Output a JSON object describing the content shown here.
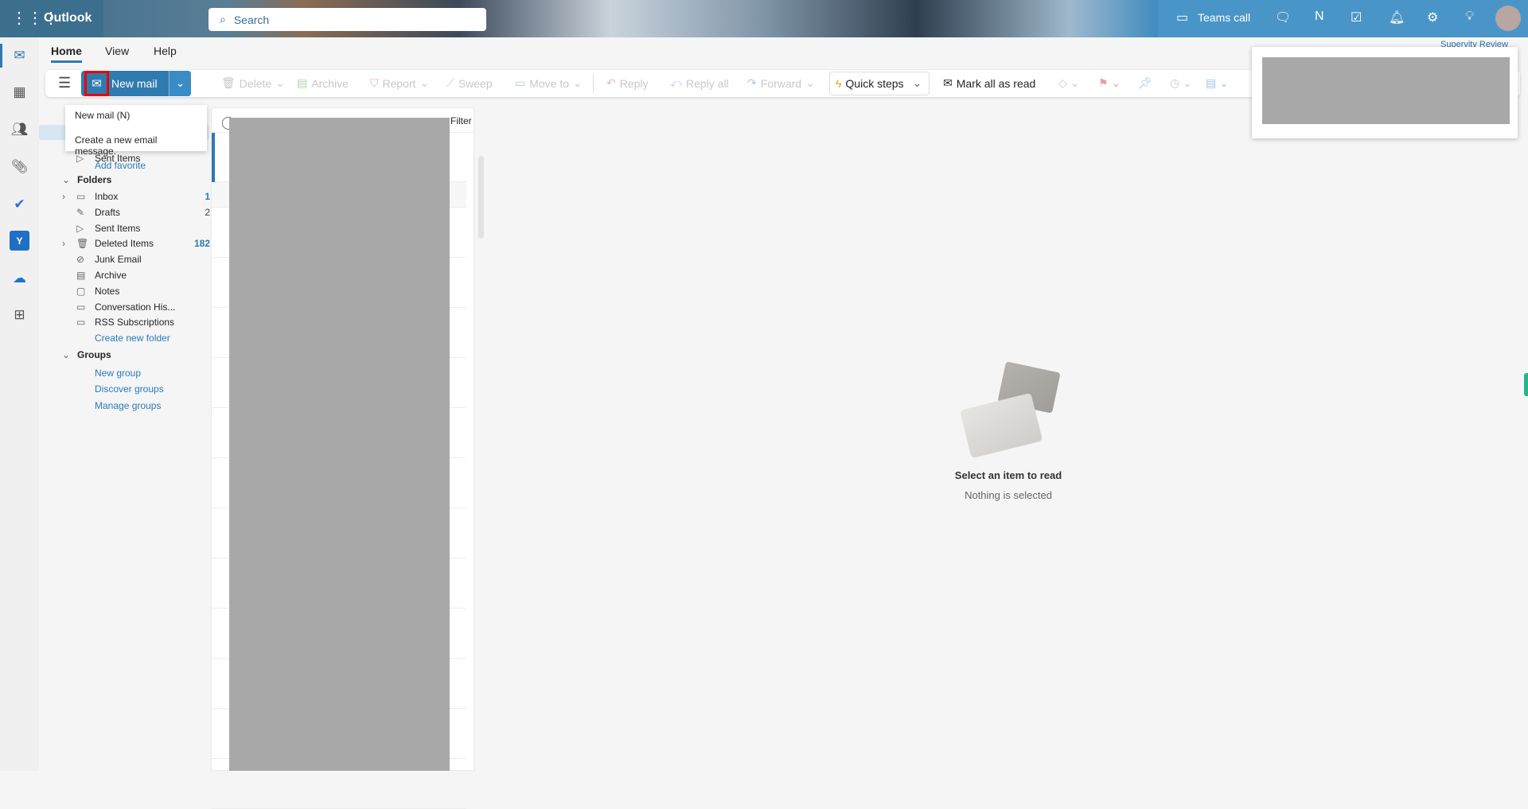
{
  "app": {
    "title": "Outlook"
  },
  "search": {
    "placeholder": "Search"
  },
  "topbar": {
    "teams_call": "Teams call",
    "icons": [
      "video-icon",
      "chat-icon",
      "onenote-icon",
      "calendar-check-icon",
      "bell-icon",
      "gear-icon",
      "lightbulb-icon"
    ]
  },
  "tabs": [
    {
      "label": "Home",
      "active": true
    },
    {
      "label": "View"
    },
    {
      "label": "Help"
    }
  ],
  "ribbon": {
    "new_mail": "New mail",
    "delete": "Delete",
    "archive": "Archive",
    "report": "Report",
    "sweep": "Sweep",
    "move_to": "Move to",
    "reply": "Reply",
    "reply_all": "Reply all",
    "forward": "Forward",
    "quick_steps": "Quick steps",
    "mark_all_read": "Mark all as read"
  },
  "tooltip": {
    "title": "New mail (N)",
    "description": "Create a new email message."
  },
  "favorites": {
    "items": [
      {
        "label": "Sent Items"
      }
    ],
    "add": "Add favorite"
  },
  "folders": {
    "header": "Folders",
    "items": [
      {
        "label": "Inbox",
        "count": "1",
        "icon": "inbox-icon"
      },
      {
        "label": "Drafts",
        "count": "2",
        "icon": "pencil-icon"
      },
      {
        "label": "Sent Items",
        "count": "",
        "icon": "send-icon"
      },
      {
        "label": "Deleted Items",
        "count": "182",
        "icon": "trash-icon"
      },
      {
        "label": "Junk Email",
        "count": "",
        "icon": "junk-icon"
      },
      {
        "label": "Archive",
        "count": "",
        "icon": "archive-icon"
      },
      {
        "label": "Notes",
        "count": "",
        "icon": "note-icon"
      },
      {
        "label": "Conversation His...",
        "count": "",
        "icon": "folder-icon"
      },
      {
        "label": "RSS Subscriptions",
        "count": "",
        "icon": "folder-icon"
      }
    ],
    "create": "Create new folder"
  },
  "groups": {
    "header": "Groups",
    "links": [
      "New group",
      "Discover groups",
      "Manage groups"
    ]
  },
  "msglist": {
    "filter": "Filter"
  },
  "reading": {
    "title": "Select an item to read",
    "subtitle": "Nothing is selected"
  },
  "popup": {
    "label": "Supervity Review"
  },
  "colors": {
    "accent": "#2f7bb0",
    "highlight": "#ff0000"
  }
}
